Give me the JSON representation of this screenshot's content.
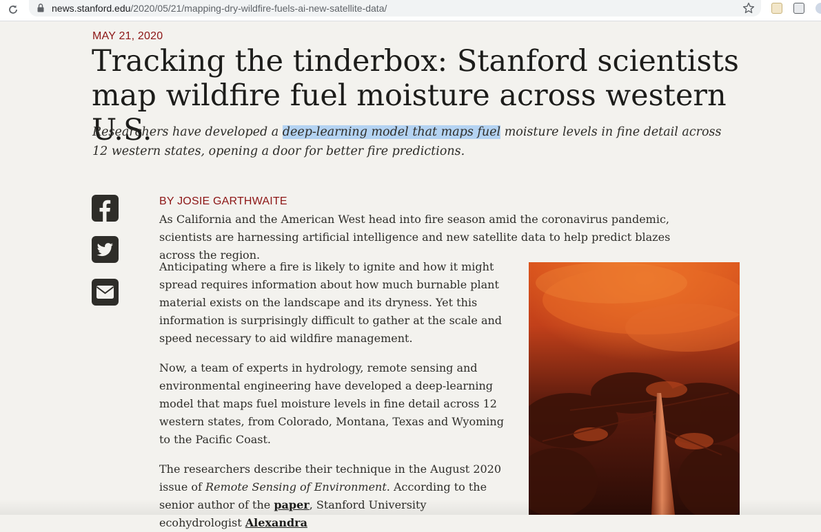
{
  "browser": {
    "url_host": "news.stanford.edu",
    "url_path": "/2020/05/21/mapping-dry-wildfire-fuels-ai-new-satellite-data/",
    "reload_icon": "reload-icon",
    "lock_icon": "lock-icon",
    "bookmark_icon": "star-icon"
  },
  "article": {
    "date": "MAY 21, 2020",
    "title": "Tracking the tinderbox: Stanford scientists map wildfire fuel moisture across western U.S.",
    "dek": {
      "before": "Researchers have developed a ",
      "highlighted": "deep-learning model that maps fuel",
      "after": " moisture levels in fine detail across 12 western states, opening a door for better fire predictions."
    },
    "byline": "BY JOSIE GARTHWAITE",
    "intro": "As California and the American West head into fire season amid the coronavirus pandemic, scientists are harnessing artificial intelligence and new satellite data to help predict blazes across the region.",
    "paragraph1": "Anticipating where a fire is likely to ignite and how it might spread requires information about how much burnable plant material exists on the landscape and its dryness. Yet this information is surprisingly difficult to gather at the scale and speed necessary to aid wildfire management.",
    "paragraph2": "Now, a team of experts in hydrology, remote sensing and environmental engineering have developed a deep-learning model that maps fuel moisture levels in fine detail across 12 western states, from Colorado, Montana, Texas and Wyoming to the Pacific Coast.",
    "paragraph3": {
      "t1": "The researchers describe their technique in the August 2020 issue of ",
      "journal": "Remote Sensing of Environment",
      "t2": ". According to the senior author of the ",
      "paper_link": "paper",
      "t3": ", Stanford University ecohydrologist ",
      "author_link": "Alexandra"
    }
  },
  "share": {
    "facebook_icon": "facebook-icon",
    "twitter_icon": "twitter-icon",
    "email_icon": "email-icon"
  },
  "colors": {
    "accent": "#8c1515",
    "page_background": "#f3f2ee",
    "highlight": "#b4d3f2"
  }
}
